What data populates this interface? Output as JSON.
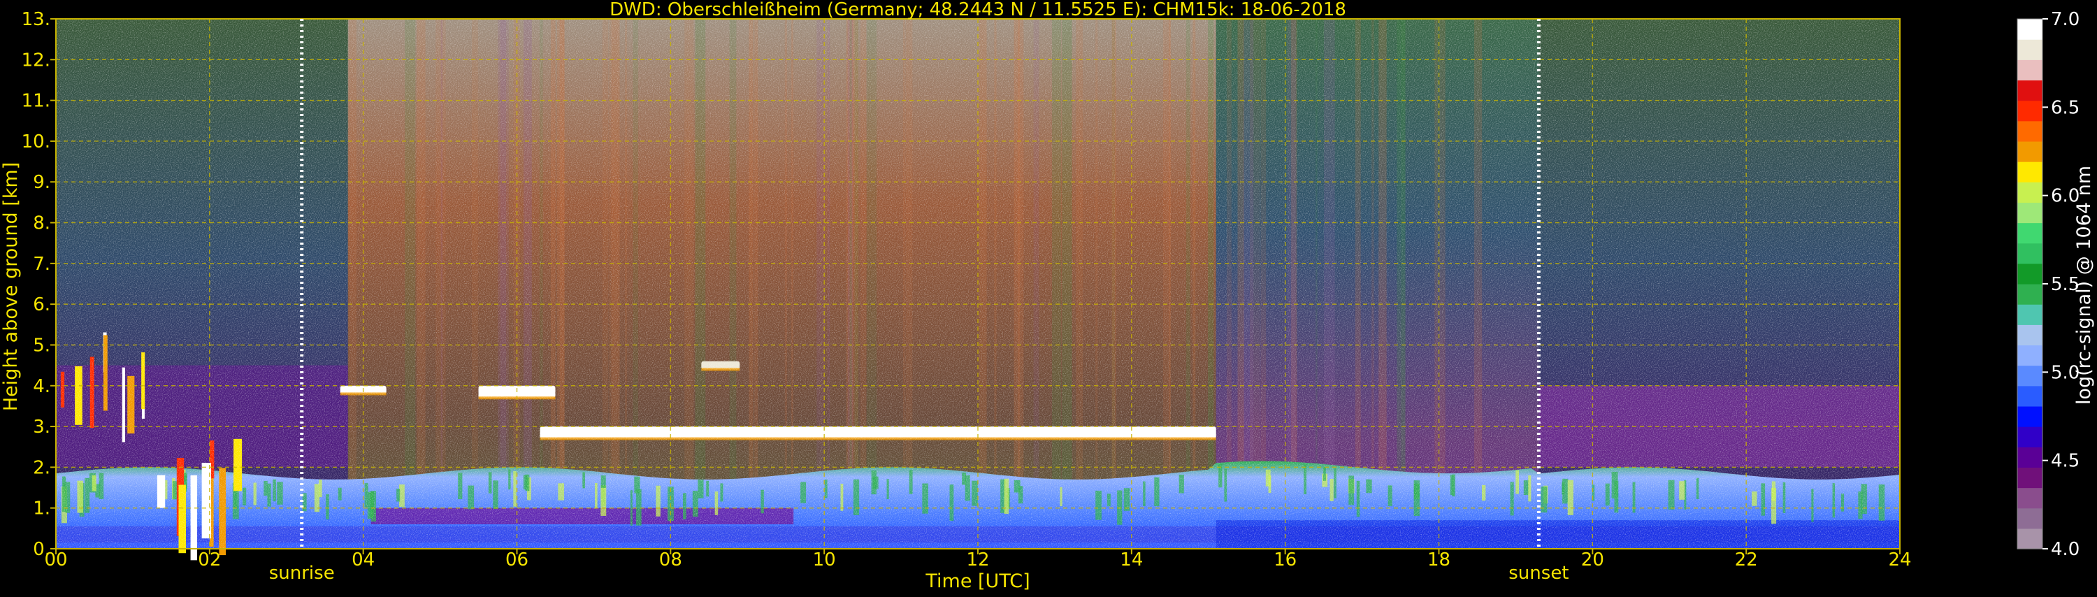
{
  "chart_data": {
    "type": "heatmap",
    "title": "DWD: Oberschleißheim (Germany; 48.2443 N / 11.5525 E):    CHM15k: 18-06-2018",
    "xlabel": "Time [UTC]",
    "ylabel": "Height above ground [km]",
    "xlim": [
      0,
      24
    ],
    "ylim": [
      0,
      13
    ],
    "x_ticks": [
      "00",
      "02",
      "04",
      "06",
      "08",
      "10",
      "12",
      "14",
      "16",
      "18",
      "20",
      "22",
      "24"
    ],
    "y_ticks": [
      "0.",
      "1.",
      "2.",
      "3.",
      "4.",
      "5.",
      "6.",
      "7.",
      "8.",
      "9.",
      "10.",
      "11.",
      "12.",
      "13."
    ],
    "grid": true,
    "annotations": [
      {
        "label": "sunrise",
        "time": 3.2
      },
      {
        "label": "sunset",
        "time": 19.3
      }
    ],
    "colorbar": {
      "label": "log(rc-signal) @ 1064 nm",
      "range": [
        4.0,
        7.0
      ],
      "ticks": [
        "4.0",
        "4.5",
        "5.0",
        "5.5",
        "6.0",
        "6.5",
        "7.0"
      ],
      "colors": [
        "#a893a9",
        "#8e6d95",
        "#8a4d8d",
        "#70107a",
        "#5a0096",
        "#3000c8",
        "#0010ff",
        "#2a5cff",
        "#5a8aff",
        "#8fb0ff",
        "#a9c4ee",
        "#4fc6b0",
        "#2fb050",
        "#129a28",
        "#30c060",
        "#40d870",
        "#9ee878",
        "#c8f050",
        "#ffe800",
        "#f29a00",
        "#ff6a00",
        "#ff2a00",
        "#e01010",
        "#eabfbf",
        "#ede8d8",
        "#ffffff"
      ]
    },
    "layers": [
      {
        "name": "boundary layer (blue/purple)",
        "time": [
          0,
          24
        ],
        "height_km": [
          0,
          1.9
        ],
        "log_signal": 5.1
      },
      {
        "name": "aerosol layer top (green)",
        "time": [
          0,
          24
        ],
        "height_km": [
          1.0,
          2.0
        ],
        "log_signal": 5.6
      },
      {
        "name": "cloud",
        "time": [
          3.7,
          4.3
        ],
        "height_km": [
          3.8,
          4.0
        ],
        "log_signal": 7.0
      },
      {
        "name": "cloud",
        "time": [
          5.5,
          6.5
        ],
        "height_km": [
          3.7,
          4.0
        ],
        "log_signal": 7.0
      },
      {
        "name": "cloud",
        "time": [
          6.3,
          15.1
        ],
        "height_km": [
          2.7,
          3.0
        ],
        "log_signal": 7.0
      },
      {
        "name": "cloud",
        "time": [
          8.4,
          8.9
        ],
        "height_km": [
          4.4,
          4.6
        ],
        "log_signal": 6.8
      },
      {
        "name": "cloud",
        "time": [
          0.0,
          1.2
        ],
        "height_km": [
          3.0,
          5.4
        ],
        "log_signal": 6.6
      },
      {
        "name": "cloud",
        "time": [
          1.3,
          2.4
        ],
        "height_km": [
          0.3,
          2.8
        ],
        "log_signal": 6.6
      }
    ]
  }
}
